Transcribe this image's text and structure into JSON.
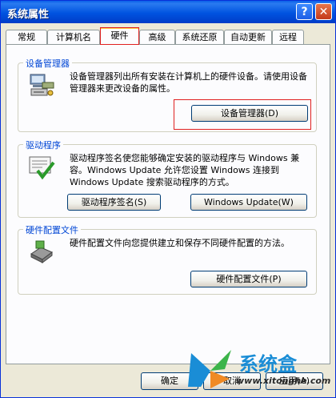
{
  "window": {
    "title": "系统属性",
    "help_label": "?",
    "close_label": "✕"
  },
  "tabs": [
    {
      "label": "常规"
    },
    {
      "label": "计算机名"
    },
    {
      "label": "硬件"
    },
    {
      "label": "高级"
    },
    {
      "label": "系统还原"
    },
    {
      "label": "自动更新"
    },
    {
      "label": "远程"
    }
  ],
  "device_manager": {
    "title": "设备管理器",
    "description": "设备管理器列出所有安装在计算机上的硬件设备。请使用设备管理器来更改设备的属性。",
    "button_label": "设备管理器(D)"
  },
  "drivers": {
    "title": "驱动程序",
    "description": "驱动程序签名使您能够确定安装的驱动程序与 Windows 兼容。Windows Update 允许您设置 Windows 连接到 Windows Update 搜索驱动程序的方式。",
    "signing_button_label": "驱动程序签名(S)",
    "update_button_label": "Windows Update(W)"
  },
  "hardware_profiles": {
    "title": "硬件配置文件",
    "description": "硬件配置文件向您提供建立和保存不同硬件配置的方法。",
    "button_label": "硬件配置文件(P)"
  },
  "footer": {
    "ok_label": "确定",
    "cancel_label": "取消",
    "apply_label": "应用(A)"
  },
  "watermark": {
    "text": "系统盒",
    "url": "www.xitonghe.com"
  },
  "colors": {
    "title_bar": "#0053E0",
    "group_title": "#0046D5",
    "highlight": "#E02020"
  }
}
